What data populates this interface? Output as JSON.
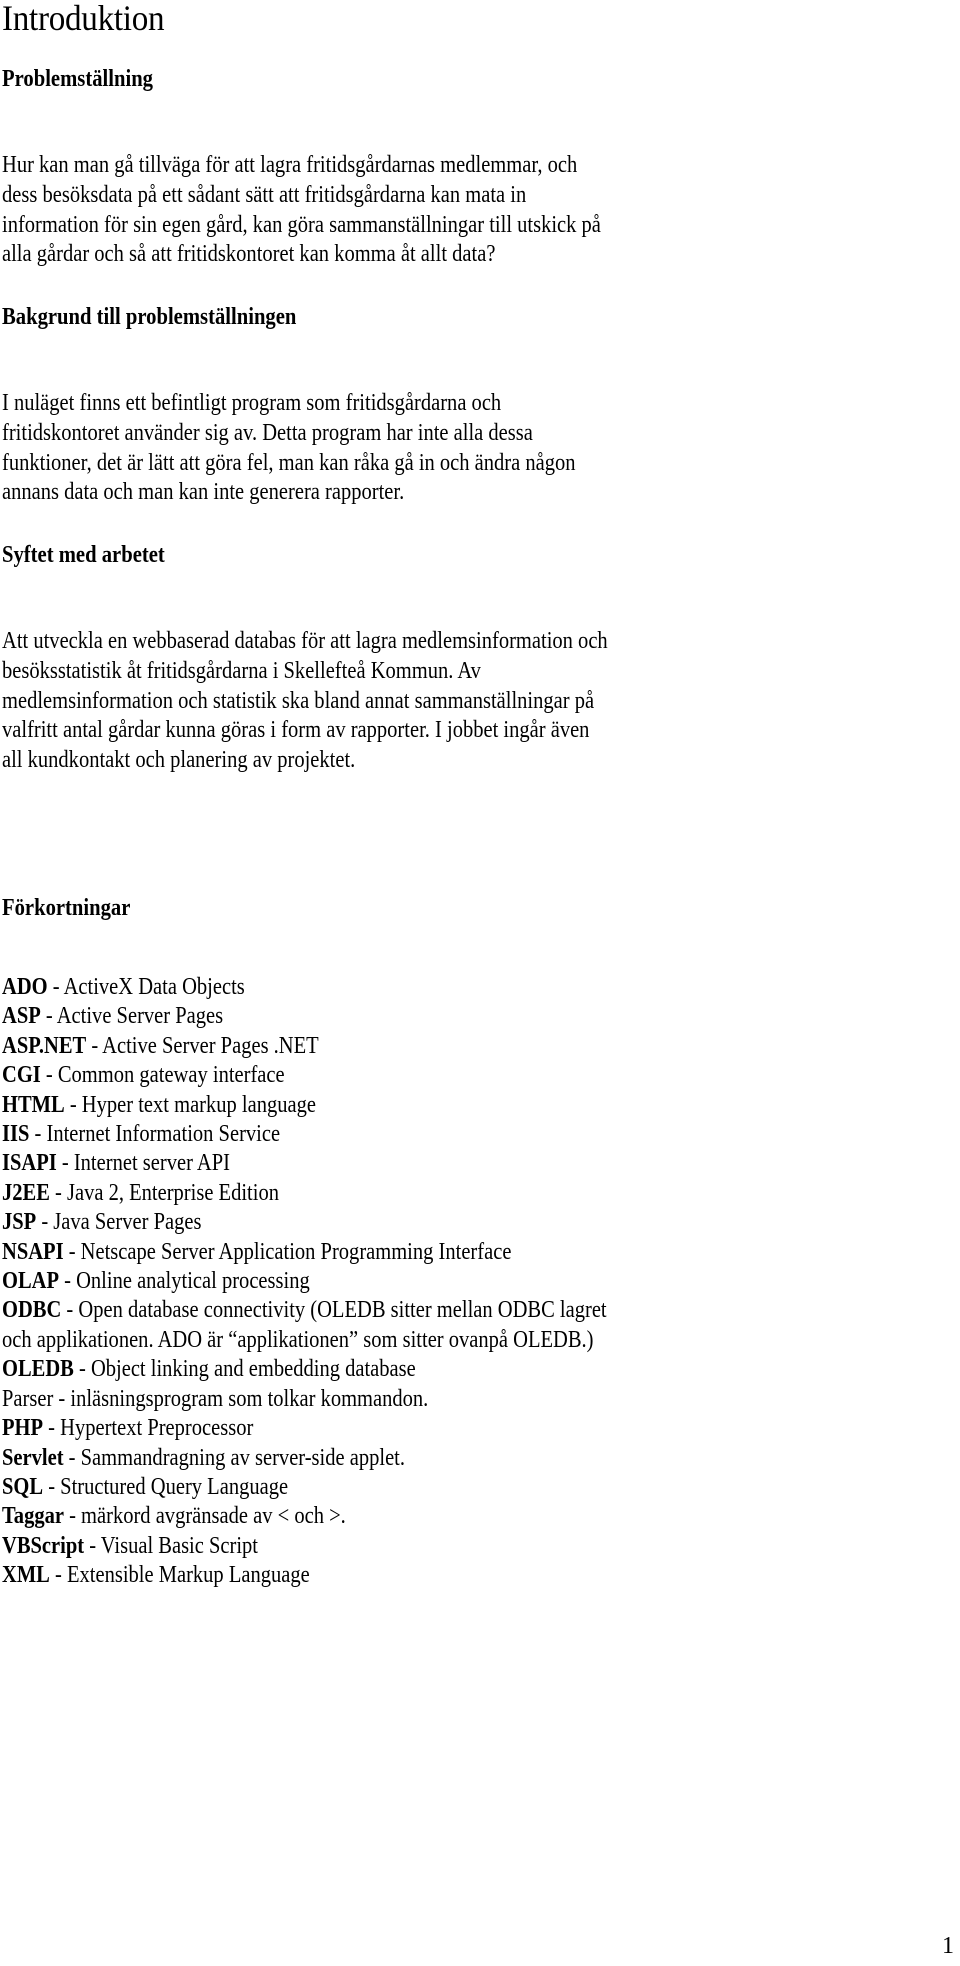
{
  "document": {
    "title": "Introduktion",
    "page_number": "1"
  },
  "sections": {
    "problem": {
      "heading": "Problemställning",
      "lines": [
        "Hur kan man gå tillväga för att lagra fritidsgårdarnas medlemmar, och",
        "dess besöksdata på ett sådant sätt att fritidsgårdarna kan mata in",
        "information för sin egen gård, kan göra sammanställningar till utskick på",
        "alla gårdar och så att fritidskontoret kan komma åt allt data?"
      ]
    },
    "background": {
      "heading": "Bakgrund till problemställningen",
      "lines": [
        "I nuläget finns ett befintligt program som fritidsgårdarna och",
        "fritidskontoret använder sig av. Detta program har inte alla dessa",
        "funktioner, det är lätt att göra fel, man kan råka gå in och ändra någon",
        "annans data och man kan inte generera rapporter."
      ]
    },
    "purpose": {
      "heading": "Syftet med arbetet",
      "lines": [
        "Att utveckla en webbaserad databas för att lagra medlemsinformation och",
        "besöksstatistik åt fritidsgårdarna i Skellefteå Kommun. Av",
        "medlemsinformation och statistik ska bland annat sammanställningar på",
        "valfritt antal gårdar kunna göras i form av rapporter. I jobbet ingår även",
        "all kundkontakt och planering av projektet."
      ]
    },
    "abbreviations": {
      "heading": "Förkortningar",
      "items": [
        {
          "term": "ADO",
          "bold": true,
          "definition": " - ActiveX Data Objects"
        },
        {
          "term": "ASP",
          "bold": true,
          "definition": " - Active Server Pages"
        },
        {
          "term": "ASP.NET",
          "bold": true,
          "definition": " - Active Server Pages .NET"
        },
        {
          "term": "CGI",
          "bold": true,
          "definition": " - Common gateway interface"
        },
        {
          "term": "HTML",
          "bold": true,
          "definition": " - Hyper text markup language"
        },
        {
          "term": "IIS",
          "bold": true,
          "definition": " - Internet Information Service"
        },
        {
          "term": "ISAPI",
          "bold": true,
          "definition": " - Internet server API"
        },
        {
          "term": "J2EE",
          "bold": true,
          "definition": " - Java 2, Enterprise Edition"
        },
        {
          "term": "JSP",
          "bold": true,
          "definition": " - Java Server Pages"
        },
        {
          "term": "NSAPI",
          "bold": true,
          "definition": " - Netscape Server Application Programming Interface"
        },
        {
          "term": "OLAP",
          "bold": true,
          "definition": " - Online analytical processing"
        },
        {
          "term": "ODBC",
          "bold": true,
          "definition": " - Open database connectivity (OLEDB sitter mellan ODBC lagret"
        },
        {
          "term": "",
          "bold": false,
          "definition": "och applikationen. ADO är “applikationen” som sitter ovanpå OLEDB.)"
        },
        {
          "term": "OLEDB",
          "bold": true,
          "definition": " - Object linking and embedding database"
        },
        {
          "term": "Parser",
          "bold": false,
          "definition": " - inläsningsprogram som tolkar kommandon."
        },
        {
          "term": "PHP",
          "bold": true,
          "definition": " - Hypertext Preprocessor"
        },
        {
          "term": "Servlet",
          "bold": true,
          "definition": " - Sammandragning av server-side applet."
        },
        {
          "term": "SQL",
          "bold": true,
          "definition": " - Structured Query Language"
        },
        {
          "term": "Taggar",
          "bold": true,
          "definition": " - märkord avgränsade av < och >."
        },
        {
          "term": "VBScript",
          "bold": true,
          "definition": " - Visual Basic Script"
        },
        {
          "term": "XML",
          "bold": true,
          "definition": " - Extensible Markup Language"
        }
      ]
    }
  }
}
